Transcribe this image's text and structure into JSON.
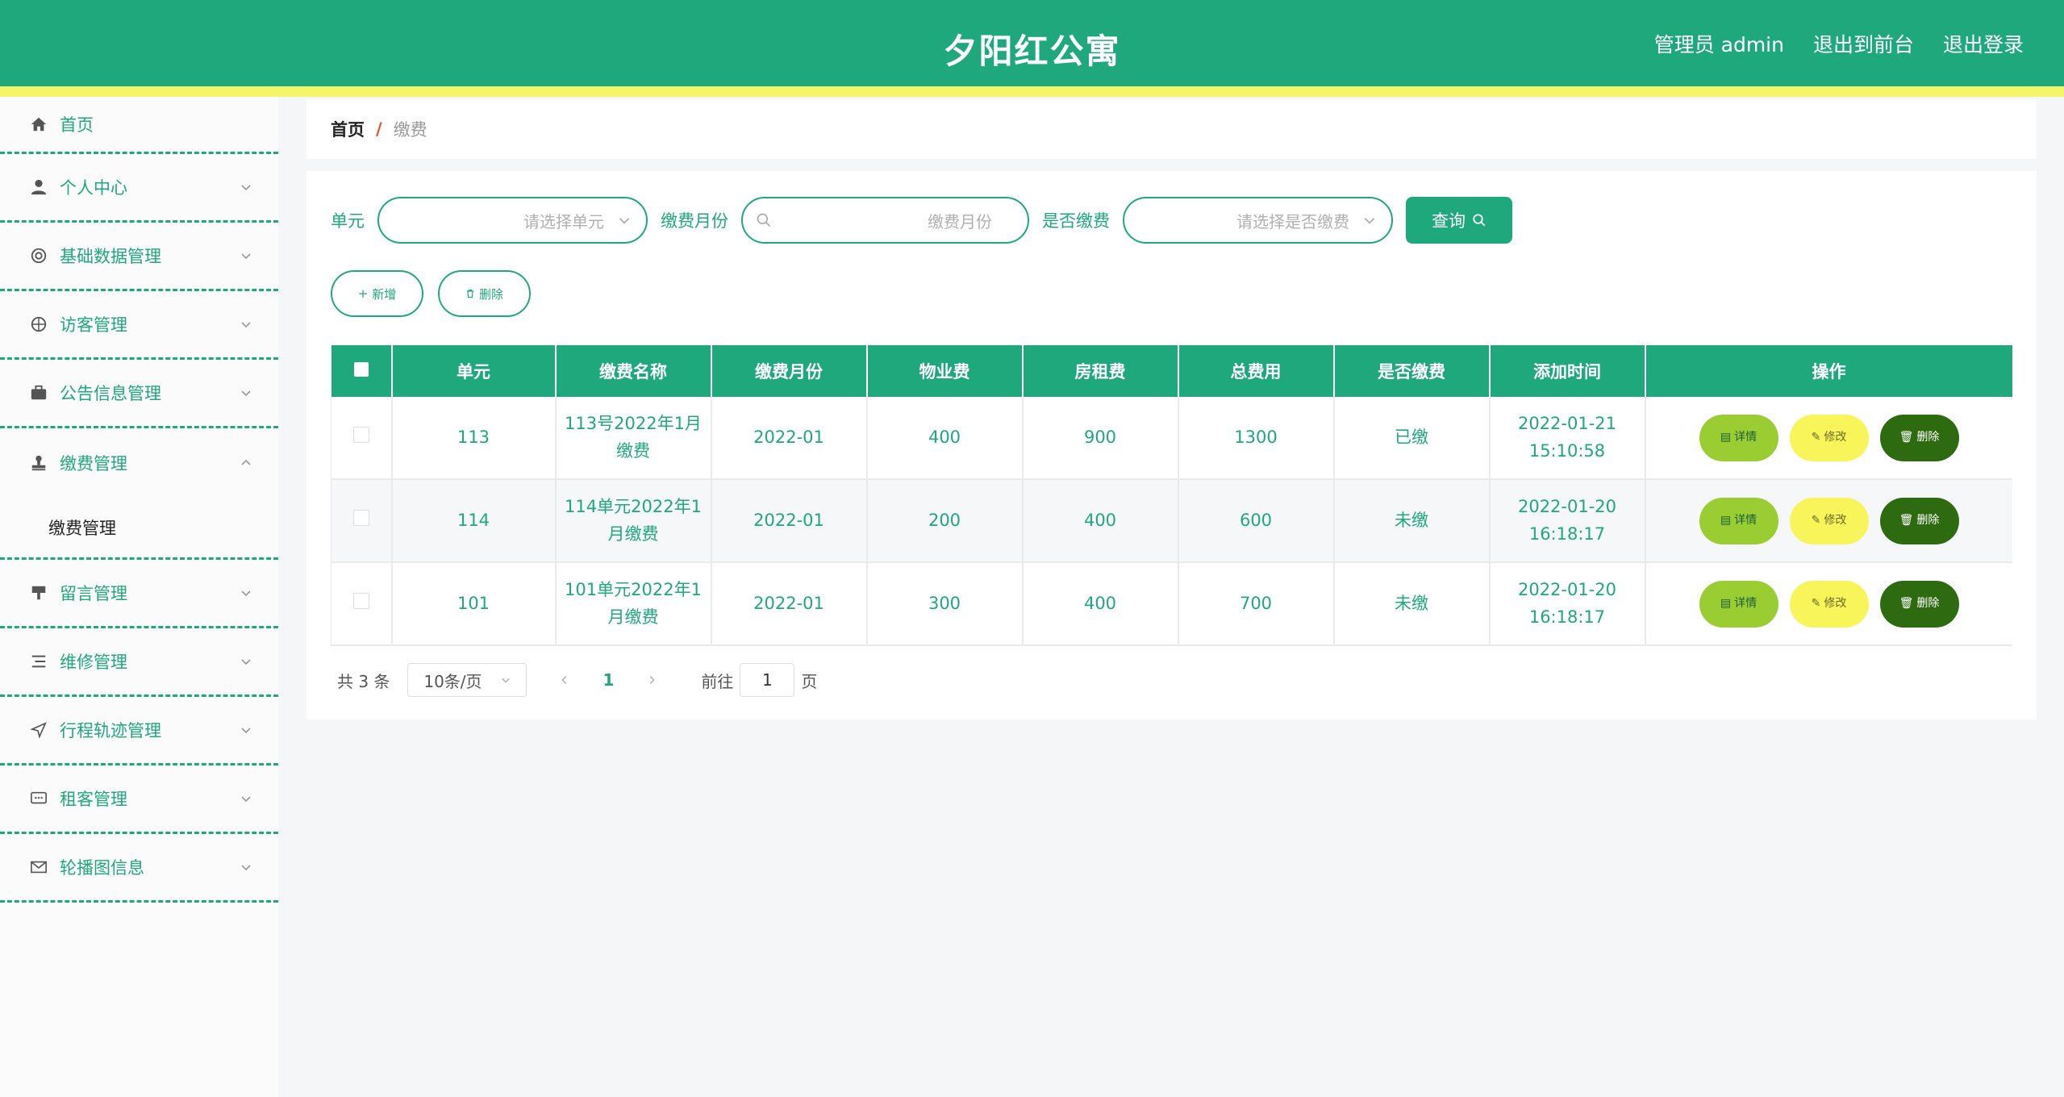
{
  "header": {
    "title": "夕阳红公寓",
    "admin": "管理员 admin",
    "to_front": "退出到前台",
    "logout": "退出登录"
  },
  "sidebar": {
    "items": [
      {
        "label": "首页",
        "icon": "home-icon"
      },
      {
        "label": "个人中心",
        "icon": "user-icon"
      },
      {
        "label": "基础数据管理",
        "icon": "lifebuoy-icon"
      },
      {
        "label": "访客管理",
        "icon": "compass-icon"
      },
      {
        "label": "公告信息管理",
        "icon": "briefcase-icon"
      },
      {
        "label": "缴费管理",
        "icon": "stamp-icon",
        "expanded": true
      },
      {
        "label": "留言管理",
        "icon": "podium-icon"
      },
      {
        "label": "维修管理",
        "icon": "list-icon"
      },
      {
        "label": "行程轨迹管理",
        "icon": "send-icon"
      },
      {
        "label": "租客管理",
        "icon": "chat-icon"
      },
      {
        "label": "轮播图信息",
        "icon": "mail-icon"
      }
    ],
    "sub_item": "缴费管理"
  },
  "breadcrumb": {
    "home": "首页",
    "sep": "/",
    "current": "缴费"
  },
  "filters": {
    "unit_label": "单元",
    "unit_placeholder": "请选择单元",
    "month_label": "缴费月份",
    "month_placeholder": "缴费月份",
    "paid_label": "是否缴费",
    "paid_placeholder": "请选择是否缴费",
    "search_button": "查询"
  },
  "actions": {
    "add": "新增",
    "delete": "删除"
  },
  "table": {
    "headers": [
      "单元",
      "缴费名称",
      "缴费月份",
      "物业费",
      "房租费",
      "总费用",
      "是否缴费",
      "添加时间",
      "操作"
    ],
    "rows": [
      {
        "unit": "113",
        "name": "113号2022年1月缴费",
        "month": "2022-01",
        "property_fee": "400",
        "rent_fee": "900",
        "total": "1300",
        "paid": "已缴",
        "time": "2022-01-21 15:10:58"
      },
      {
        "unit": "114",
        "name": "114单元2022年1月缴费",
        "month": "2022-01",
        "property_fee": "200",
        "rent_fee": "400",
        "total": "600",
        "paid": "未缴",
        "time": "2022-01-20 16:18:17"
      },
      {
        "unit": "101",
        "name": "101单元2022年1月缴费",
        "month": "2022-01",
        "property_fee": "300",
        "rent_fee": "400",
        "total": "700",
        "paid": "未缴",
        "time": "2022-01-20 16:18:17"
      }
    ],
    "op_detail": "详情",
    "op_edit": "修改",
    "op_delete": "删除"
  },
  "pagination": {
    "total": "共 3 条",
    "page_size": "10条/页",
    "current_page": "1",
    "goto_label": "前往",
    "goto_value": "1",
    "page_suffix": "页"
  },
  "colors": {
    "primary": "#1fa87b",
    "accent_yellow": "#f4f667",
    "detail": "#9acd32",
    "edit": "#f8f55a",
    "delete": "#2e6a0f"
  }
}
